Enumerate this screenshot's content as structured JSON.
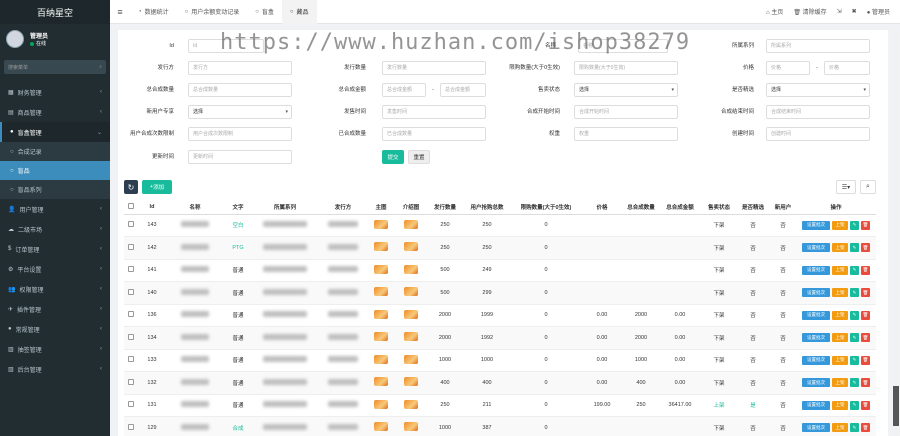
{
  "brand": "百纳星空",
  "user": {
    "name": "管理员",
    "status": "在线"
  },
  "sidebar": {
    "search_placeholder": "搜索菜单",
    "items": [
      {
        "label": "财务管理",
        "icon": "bank-icon"
      },
      {
        "label": "商品管理",
        "icon": "grid-icon"
      },
      {
        "label": "盲盒管理",
        "icon": "circle-icon",
        "open": true
      },
      {
        "label": "用户管理",
        "icon": "user-icon"
      },
      {
        "label": "二级市场",
        "icon": "market-icon"
      },
      {
        "label": "订单管理",
        "icon": "dollar-icon"
      },
      {
        "label": "平台设置",
        "icon": "gear-icon"
      },
      {
        "label": "权限管理",
        "icon": "group-icon"
      },
      {
        "label": "插件管理",
        "icon": "rocket-icon"
      },
      {
        "label": "常规管理",
        "icon": "circle-icon"
      },
      {
        "label": "抽签管理",
        "icon": "list-icon"
      },
      {
        "label": "后台管理",
        "icon": "list-icon"
      }
    ],
    "sub_items": [
      {
        "label": "合成记录"
      },
      {
        "label": "盲品",
        "active": true
      },
      {
        "label": "盲品系列"
      }
    ]
  },
  "header": {
    "tabs": [
      {
        "label": "数据统计",
        "icon": "dashboard-icon"
      },
      {
        "label": "用户余额变动记录",
        "icon": "circle-icon"
      },
      {
        "label": "盲盒",
        "icon": "circle-icon"
      },
      {
        "label": "藏品",
        "icon": "circle-icon",
        "active": true
      }
    ],
    "home": "主页",
    "clear_cache": "清除缓存",
    "admin": "管理员"
  },
  "filters": {
    "id_label": "Id",
    "id_ph": "Id",
    "name_label": "名称",
    "name_ph": "名称",
    "series_label": "所属系列",
    "series_ph": "所属系列",
    "issuer_label": "发行方",
    "issuer_ph": "发行方",
    "issue_qty_label": "发行数量",
    "issue_qty_ph": "发行数量",
    "limit_label": "限购数量(大于0生效)",
    "limit_ph": "限购数量(大于0生效)",
    "price_label": "价格",
    "price_ph1": "价格",
    "price_ph2": "价格",
    "dash": "-",
    "total_label": "总合成数量",
    "total_ph": "总合成数量",
    "rate_label": "总合成金额",
    "rate_ph1": "总合成金额",
    "rate_ph2": "总合成金额",
    "status_label": "售卖状态",
    "status_value": "选择",
    "recommend_label": "是否精选",
    "recommend_value": "选择",
    "newuser_label": "新用户专享",
    "newuser_value": "选择",
    "time_label": "发售时间",
    "time_ph": "发售时间",
    "start_label": "合成开始时间",
    "start_ph": "合成开始时间",
    "end_label": "合成结束时间",
    "end_ph": "合成结束时间",
    "user_total_label": "用户合成次数限制",
    "user_total_ph": "用户合成次数限制",
    "done_label": "已合成数量",
    "done_ph": "已合成数量",
    "sort_label": "权重",
    "sort_ph": "权重",
    "create_label": "创建时间",
    "create_ph": "创建时间",
    "update_label": "更新时间",
    "update_ph": "更新时间",
    "submit": "提交",
    "reset": "重置"
  },
  "toolbar": {
    "add": "添加"
  },
  "table": {
    "headers": [
      "Id",
      "名称",
      "文字",
      "所属系列",
      "发行方",
      "主图",
      "介绍图",
      "发行数量",
      "用户抢购总数",
      "限购数量(大于0生效)",
      "价格",
      "总合成数量",
      "总合成金额",
      "售卖状态",
      "是否精选",
      "新用户",
      "操作"
    ],
    "rows": [
      {
        "id": "143",
        "word": "空白",
        "issue": "250",
        "buy": "250",
        "limit": "0",
        "price": "",
        "total": "",
        "amount": "",
        "status": "下架",
        "rec": "否",
        "new": "否"
      },
      {
        "id": "142",
        "word": "PTG",
        "issue": "250",
        "buy": "250",
        "limit": "0",
        "price": "",
        "total": "",
        "amount": "",
        "status": "下架",
        "rec": "否",
        "new": "否"
      },
      {
        "id": "141",
        "word": "普通",
        "issue": "500",
        "buy": "249",
        "limit": "0",
        "price": "",
        "total": "",
        "amount": "",
        "status": "下架",
        "rec": "否",
        "new": "否"
      },
      {
        "id": "140",
        "word": "普通",
        "issue": "500",
        "buy": "299",
        "limit": "0",
        "price": "",
        "total": "",
        "amount": "",
        "status": "下架",
        "rec": "否",
        "new": "否"
      },
      {
        "id": "136",
        "word": "普通",
        "issue": "2000",
        "buy": "1999",
        "limit": "0",
        "price": "0.00",
        "total": "2000",
        "amount": "0.00",
        "status": "下架",
        "rec": "否",
        "new": "否"
      },
      {
        "id": "134",
        "word": "普通",
        "issue": "2000",
        "buy": "1992",
        "limit": "0",
        "price": "0.00",
        "total": "2000",
        "amount": "0.00",
        "status": "下架",
        "rec": "否",
        "new": "否"
      },
      {
        "id": "133",
        "word": "普通",
        "issue": "1000",
        "buy": "1000",
        "limit": "0",
        "price": "0.00",
        "total": "1000",
        "amount": "0.00",
        "status": "下架",
        "rec": "否",
        "new": "否"
      },
      {
        "id": "132",
        "word": "普通",
        "issue": "400",
        "buy": "400",
        "limit": "0",
        "price": "0.00",
        "total": "400",
        "amount": "0.00",
        "status": "下架",
        "rec": "否",
        "new": "否"
      },
      {
        "id": "131",
        "word": "普通",
        "issue": "250",
        "buy": "211",
        "limit": "0",
        "price": "199.00",
        "total": "250",
        "amount": "36417.00",
        "status": "上架",
        "rec": "是",
        "new": "否"
      },
      {
        "id": "129",
        "word": "合成",
        "issue": "1000",
        "buy": "387",
        "limit": "0",
        "price": "",
        "total": "",
        "amount": "",
        "status": "下架",
        "rec": "否",
        "new": "否"
      }
    ],
    "op_config": "设置批次",
    "op_up": "上架"
  },
  "watermark": "https://www.huzhan.com/ishop38279",
  "colors": {
    "sidebar": "#222d32",
    "accent": "#3c8dbc",
    "success": "#18bc9c",
    "danger": "#e74c3c",
    "warning": "#f39c12"
  }
}
